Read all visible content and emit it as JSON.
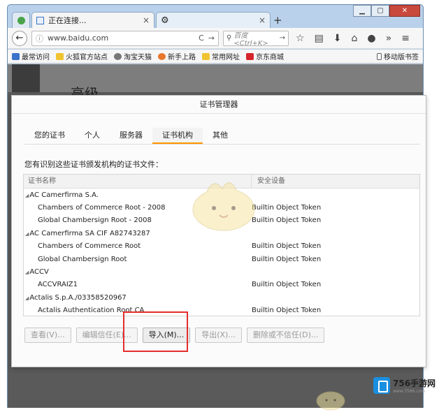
{
  "browser": {
    "tabs": [
      {
        "title": ""
      },
      {
        "title": "正在连接..."
      },
      {
        "title": ""
      }
    ],
    "url": "www.baidu.com",
    "search_placeholder": "百度 <Ctrl+K>",
    "bookmarks": [
      {
        "label": "最常访问",
        "color": "#3a73c9"
      },
      {
        "label": "火狐官方站点",
        "color": "#f0c330"
      },
      {
        "label": "淘宝天猫",
        "color": "#777777"
      },
      {
        "label": "新手上路",
        "color": "#e8772e"
      },
      {
        "label": "常用网址",
        "color": "#f0c330"
      },
      {
        "label": "京东商城",
        "color": "#d6242a"
      }
    ],
    "mobile_bookmarks": "移动版书签",
    "page_heading": "高级"
  },
  "dialog": {
    "title": "证书管理器",
    "tabs": [
      "您的证书",
      "个人",
      "服务器",
      "证书机构",
      "其他"
    ],
    "active_tab": "证书机构",
    "description": "您有识别这些证书颁发机构的证书文件：",
    "columns": [
      "证书名称",
      "安全设备"
    ],
    "rows": [
      {
        "name": "AC Camerfirma S.A.",
        "device": "",
        "group": true
      },
      {
        "name": "Chambers of Commerce Root - 2008",
        "device": "Builtin Object Token",
        "group": false
      },
      {
        "name": "Global Chambersign Root - 2008",
        "device": "Builtin Object Token",
        "group": false
      },
      {
        "name": "AC Camerfirma SA CIF A82743287",
        "device": "",
        "group": true
      },
      {
        "name": "Chambers of Commerce Root",
        "device": "Builtin Object Token",
        "group": false
      },
      {
        "name": "Global Chambersign Root",
        "device": "Builtin Object Token",
        "group": false
      },
      {
        "name": "ACCV",
        "device": "",
        "group": true
      },
      {
        "name": "ACCVRAIZ1",
        "device": "Builtin Object Token",
        "group": false
      },
      {
        "name": "Actalis S.p.A./03358520967",
        "device": "",
        "group": true
      },
      {
        "name": "Actalis Authentication Root CA",
        "device": "Builtin Object Token",
        "group": false
      }
    ],
    "buttons": [
      {
        "label": "查看(V)...",
        "enabled": false
      },
      {
        "label": "编辑信任(E)...",
        "enabled": false
      },
      {
        "label": "导入(M)...",
        "enabled": true
      },
      {
        "label": "导出(X)...",
        "enabled": false
      },
      {
        "label": "删除或不信任(D)...",
        "enabled": false
      }
    ]
  },
  "logo": {
    "name": "756手游网",
    "url": "www.7566.com"
  },
  "colors": {
    "accent_tab": "#ff9500",
    "highlight": "#e52d2d"
  }
}
